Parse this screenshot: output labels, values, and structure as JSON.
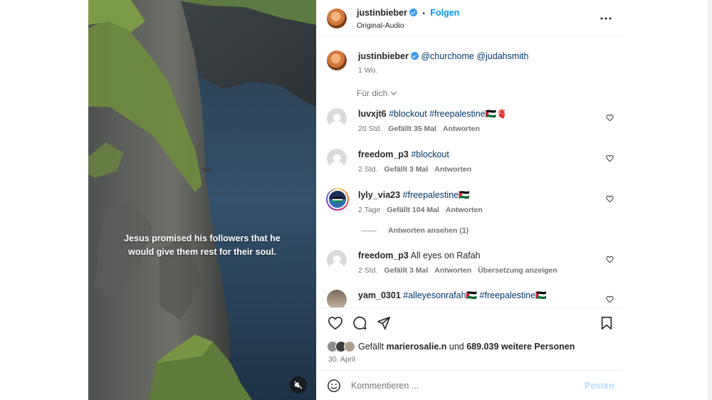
{
  "post": {
    "caption_overlay": "Jesus promised his followers that he would give them rest for their soul.",
    "mute_icon": "speaker-muted-icon"
  },
  "header": {
    "username": "justinbieber",
    "separator": "•",
    "follow_label": "Folgen",
    "audio": "Original-Audio",
    "more_icon": "more-horizontal-icon"
  },
  "owner_caption": {
    "username": "justinbieber",
    "mentions": "@churchome @judahsmith",
    "time": "1 Wo."
  },
  "filter": {
    "label": "Für dich"
  },
  "comments": [
    {
      "username": "luvxjt6",
      "text": "#blockout #freepalestine🇵🇸🫀",
      "time": "20 Std.",
      "likes": "Gefällt 35 Mal",
      "reply": "Antworten"
    },
    {
      "username": "freedom_p3",
      "text": "#blockout",
      "time": "2 Std.",
      "likes": "Gefällt 3 Mal",
      "reply": "Antworten"
    },
    {
      "username": "lyly_via23",
      "text": "#freepalestine🇵🇸",
      "time": "2 Tage",
      "likes": "Gefällt 104 Mal",
      "reply": "Antworten",
      "view_replies": "Antworten ansehen (1)"
    },
    {
      "username": "freedom_p3",
      "text": "All eyes on Rafah",
      "time": "2 Std.",
      "likes": "Gefällt 3 Mal",
      "reply": "Antworten",
      "translate": "Übersetzung anzeigen"
    },
    {
      "username": "yam_0301",
      "text": "#alleyesonrafah🇵🇸 #freepalestine🇵🇸"
    }
  ],
  "actions": {
    "liked_by_prefix": "Gefällt",
    "liked_by_user": "marierosalie.n",
    "liked_by_mid": "und",
    "liked_by_count": "689.039 weitere Personen",
    "date": "30. April"
  },
  "composer": {
    "placeholder": "Kommentieren ...",
    "post_label": "Posten"
  },
  "colors": {
    "accent": "#0095f6",
    "link": "#00376b",
    "muted": "#737373"
  }
}
